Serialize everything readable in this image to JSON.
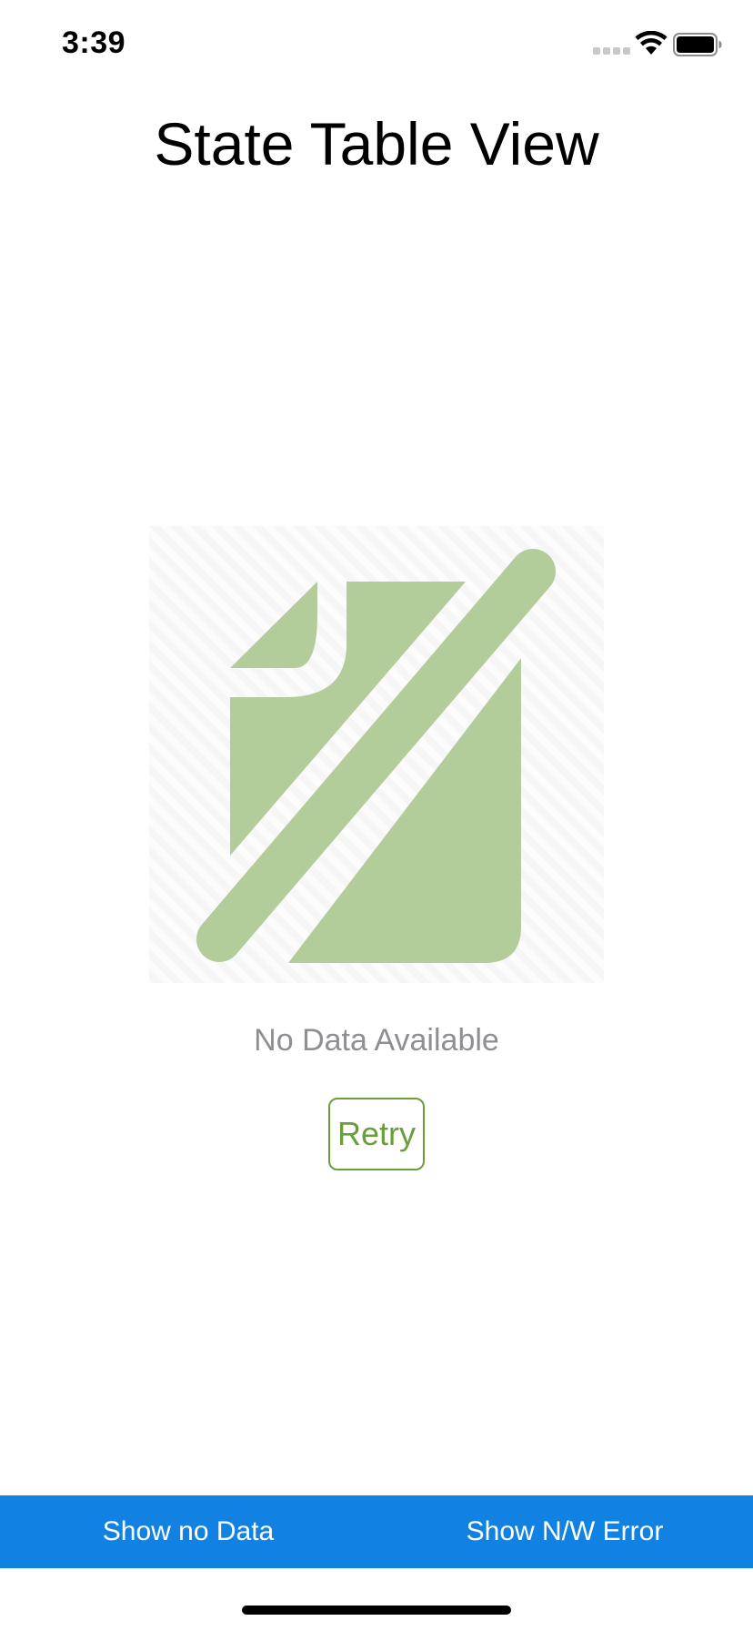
{
  "status_bar": {
    "time": "3:39",
    "icons": [
      "signal-dots-icon",
      "wifi-icon",
      "battery-icon"
    ]
  },
  "header": {
    "title": "State Table View"
  },
  "empty_state": {
    "icon": "no-data-document-icon",
    "message": "No Data Available",
    "retry_label": "Retry"
  },
  "toolbar": {
    "show_no_data_label": "Show no Data",
    "show_network_error_label": "Show N/W Error"
  },
  "colors": {
    "accent_green": "#6a9e3a",
    "icon_green": "#b2cc9a",
    "toolbar_blue": "#1282e2",
    "message_gray": "#8e8e93"
  }
}
